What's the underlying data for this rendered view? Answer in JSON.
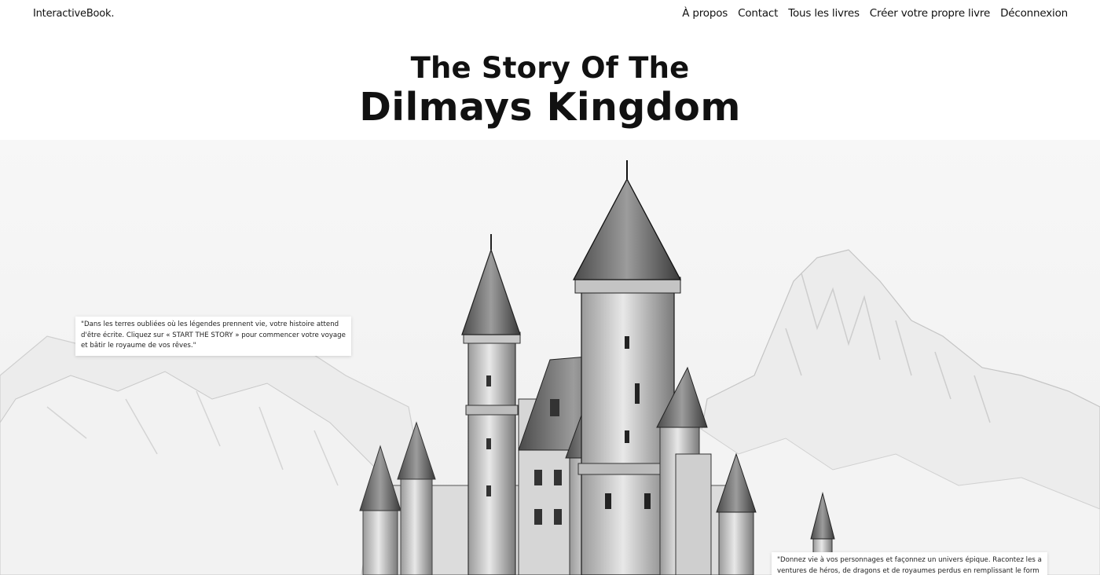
{
  "navbar": {
    "brand": "InteractiveBook.",
    "links": [
      "À propos",
      "Contact",
      "Tous les livres",
      "Créer votre propre livre",
      "Déconnexion"
    ]
  },
  "hero": {
    "title_line1": "The Story Of The",
    "title_line2": "Dilmays Kingdom",
    "image_icon": "castle-illustration"
  },
  "quotes": {
    "left": "\"Dans les terres oubliées où les légendes prennent vie, votre histoire attend d'être écrite. Cliquez sur « START THE STORY » pour commencer votre voyage et bâtir le royaume de vos rêves.\"",
    "right": "\"Donnez vie à vos personnages et façonnez un univers épique. Racontez les aventures de héros, de dragons et de royaumes perdus en remplissant le formulaire magiq"
  }
}
